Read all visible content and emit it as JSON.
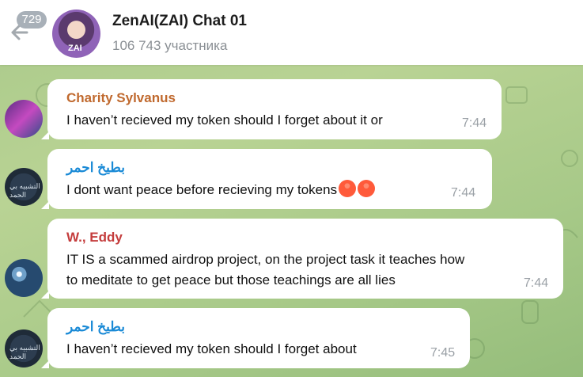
{
  "header": {
    "unread_count": "729",
    "title": "ZenAI(ZAI) Chat 01",
    "subtitle": "106 743 участника",
    "avatar_label": "ZAI"
  },
  "messages": [
    {
      "sender": "Charity Sylvanus",
      "sender_color": "#c0692e",
      "text": "I haven’t recieved my token should I forget about it or",
      "time": "7:44"
    },
    {
      "sender": "بطيخ احمر",
      "sender_color": "#1a8ad6",
      "text": "I dont want peace before recieving my tokens",
      "emoji": [
        "angry-face-icon",
        "angry-face-icon"
      ],
      "time": "7:44"
    },
    {
      "sender": "W., Eddy",
      "sender_color": "#c43c3c",
      "text": "IT IS a scammed airdrop project, on the project task it teaches how\nto meditate to get peace but those teachings are all lies",
      "time": "7:44"
    },
    {
      "sender": "بطيخ احمر",
      "sender_color": "#1a8ad6",
      "text": "I haven’t recieved my token should I forget about",
      "time": "7:45"
    }
  ],
  "avatar_glyph": "ﺍﻟﺘﺸﺒﻴﻪ ﺑﻲ ﺍﻟﺤﻤﺪ"
}
